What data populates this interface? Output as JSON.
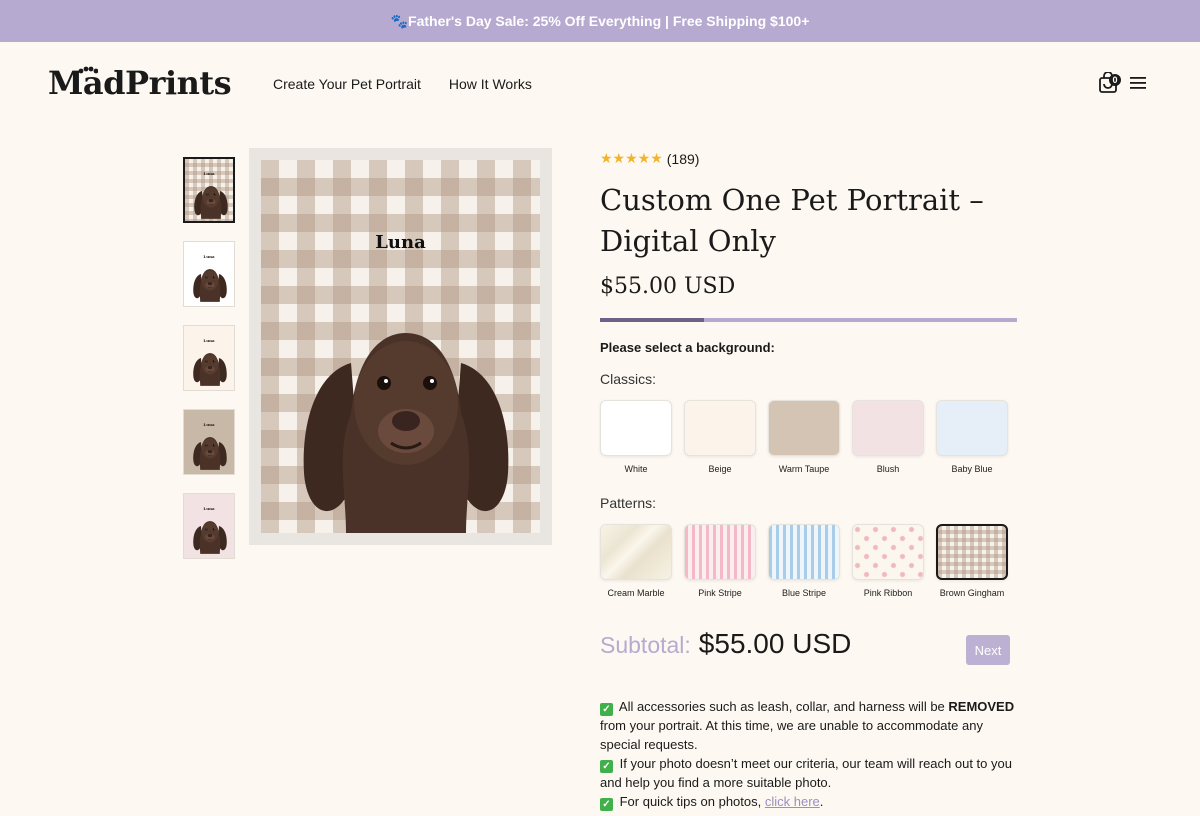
{
  "announcement": "🐾Father's Day Sale: 25% Off Everything | Free Shipping $100+",
  "brand": {
    "logo_text": "MadPrints"
  },
  "nav": {
    "items": [
      "Create Your Pet Portrait",
      "How It Works"
    ]
  },
  "header": {
    "cart_count": "0"
  },
  "gallery": {
    "pet_name": "Luna",
    "thumbnails": [
      {
        "background": "brown-gingham",
        "name": "Luna"
      },
      {
        "background": "white",
        "name": "Luna"
      },
      {
        "background": "beige",
        "name": "Luna"
      },
      {
        "background": "warm-taupe",
        "name": "Luna"
      },
      {
        "background": "blush",
        "name": "Luna"
      }
    ]
  },
  "product": {
    "stars": "★★★★★",
    "review_count": "(189)",
    "title": "Custom One Pet Portrait – Digital Only",
    "price": "$55.00 USD",
    "progress_fraction": 0.25
  },
  "options": {
    "prompt": "Please select a background:",
    "classics_label": "Classics:",
    "classics": [
      {
        "name": "White",
        "color": "#ffffff"
      },
      {
        "name": "Beige",
        "color": "#fcf4ea"
      },
      {
        "name": "Warm Taupe",
        "color": "#d3c4b4"
      },
      {
        "name": "Blush",
        "color": "#f3e2e4"
      },
      {
        "name": "Baby Blue",
        "color": "#e6eef8"
      }
    ],
    "patterns_label": "Patterns:",
    "patterns": [
      {
        "name": "Cream Marble"
      },
      {
        "name": "Pink Stripe"
      },
      {
        "name": "Blue Stripe"
      },
      {
        "name": "Pink Ribbon"
      },
      {
        "name": "Brown Gingham",
        "selected": true
      }
    ]
  },
  "checkout": {
    "subtotal_label": "Subtotal:",
    "subtotal_value": "$55.00 USD",
    "next_label": "Next"
  },
  "notes": {
    "line1_pre": " All accessories such as leash, collar, and harness will be ",
    "line1_bold": "REMOVED",
    "line1_post": " from your portrait. At this time, we are unable to accommodate any special requests.",
    "line2": " If your photo doesn’t meet our criteria, our team will reach out to you and help you find a more suitable photo.",
    "line3_pre": " For quick tips on photos, ",
    "line3_link": "click here",
    "line3_post": "."
  },
  "colors": {
    "accent": "#b6aad0",
    "accent_dark": "#6e6188",
    "page_bg": "#fdf9f2",
    "star": "#f1b52c"
  }
}
